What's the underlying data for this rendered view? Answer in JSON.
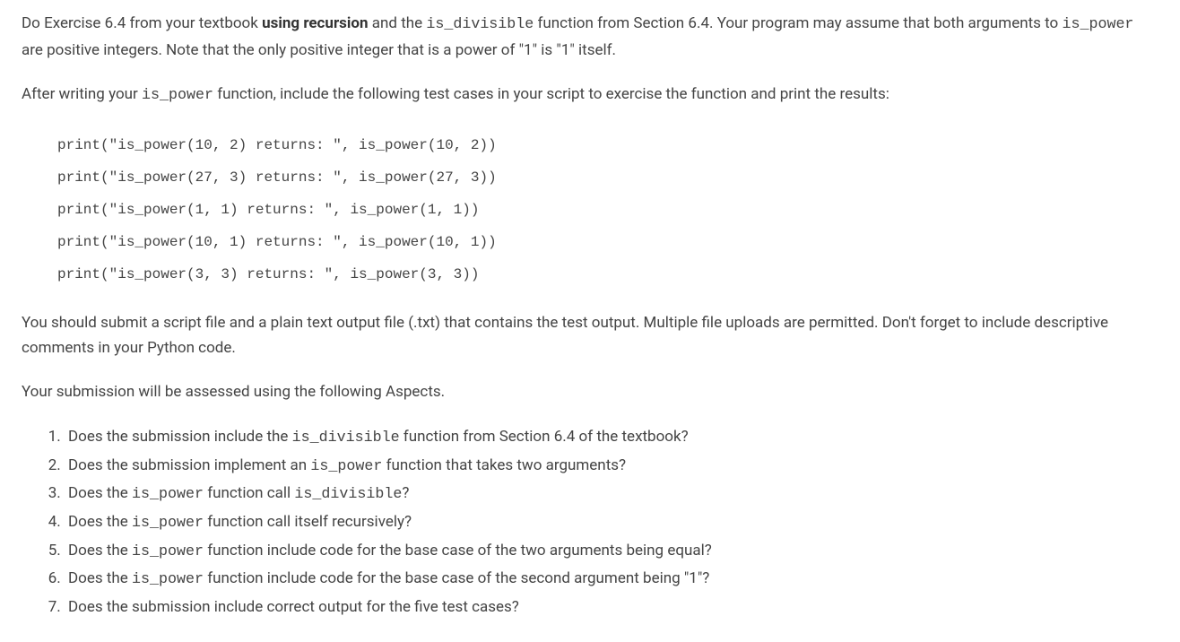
{
  "intro": {
    "p1_pre": "Do Exercise 6.4 from your textbook ",
    "p1_bold": "using recursion",
    "p1_mid1": " and the ",
    "p1_code1": "is_divisible",
    "p1_mid2": " function from Section 6.4.  Your program may assume that both arguments to ",
    "p1_code2": "is_power",
    "p1_end": " are positive integers. Note that the only positive integer that is a power of \"1\" is \"1\" itself.",
    "p2_pre": "After writing your ",
    "p2_code": "is_power",
    "p2_end": " function, include the following test cases in your script to exercise the function and print the results:"
  },
  "code_lines": [
    "print(\"is_power(10, 2) returns: \", is_power(10, 2))",
    "print(\"is_power(27, 3) returns: \", is_power(27, 3))",
    "print(\"is_power(1, 1) returns: \", is_power(1, 1))",
    "print(\"is_power(10, 1) returns: \", is_power(10, 1))",
    "print(\"is_power(3, 3) returns: \", is_power(3, 3))"
  ],
  "submission_note": "You should submit a script file and a plain text output file (.txt) that contains the test output. Multiple file uploads are permitted. Don't forget to include descriptive comments in your Python code.",
  "aspects_intro": "Your submission will be assessed using the following Aspects.",
  "aspects": {
    "a1_pre": "Does the submission include the ",
    "a1_code": "is_divisible",
    "a1_end": " function from Section 6.4 of the textbook?",
    "a2_pre": "Does the submission implement an ",
    "a2_code": "is_power",
    "a2_end": " function that takes two arguments?",
    "a3_pre": "Does the ",
    "a3_code1": "is_power",
    "a3_mid": " function call ",
    "a3_code2": "is_divisible",
    "a3_end": "?",
    "a4_pre": "Does the ",
    "a4_code": "is_power",
    "a4_end": " function call itself recursively?",
    "a5_pre": "Does the ",
    "a5_code": "is_power",
    "a5_end": " function include code for the base case of the two arguments being equal?",
    "a6_pre": "Does the ",
    "a6_code": "is_power",
    "a6_end": " function include code for the base case of the second argument being \"1\"?",
    "a7": "Does the submission include correct output for the five test cases?"
  }
}
